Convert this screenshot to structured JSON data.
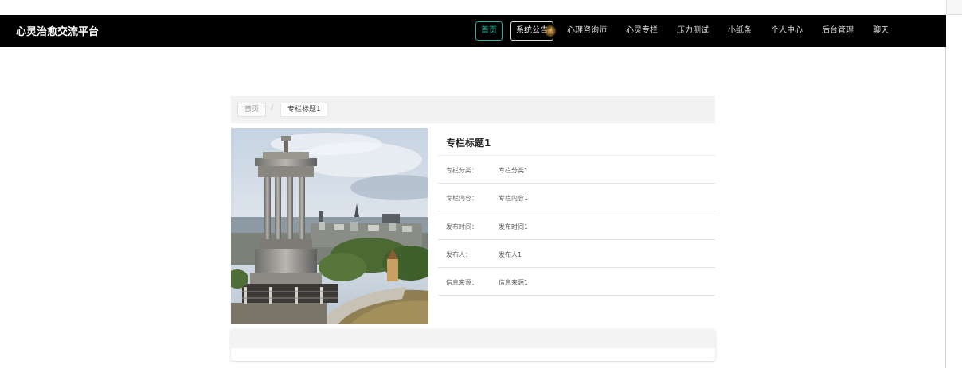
{
  "app": {
    "brand": "心灵治愈交流平台"
  },
  "nav": {
    "items": [
      {
        "label": "首页",
        "state": "active"
      },
      {
        "label": "系统公告",
        "state": "hover"
      },
      {
        "label": "心理咨询师",
        "state": "normal"
      },
      {
        "label": "心灵专栏",
        "state": "normal"
      },
      {
        "label": "压力测试",
        "state": "normal"
      },
      {
        "label": "小纸条",
        "state": "normal"
      },
      {
        "label": "个人中心",
        "state": "normal"
      },
      {
        "label": "后台管理",
        "state": "normal"
      },
      {
        "label": "聊天",
        "state": "normal"
      }
    ]
  },
  "breadcrumb": {
    "home": "首页",
    "separator": "/",
    "current": "专栏标题1"
  },
  "detail": {
    "title": "专栏标题1",
    "fields": [
      {
        "label": "专栏分类：",
        "value": "专栏分类1"
      },
      {
        "label": "专栏内容：",
        "value": "专栏内容1"
      },
      {
        "label": "发布时间：",
        "value": "发布时间1"
      },
      {
        "label": "发布人：",
        "value": "发布人1"
      },
      {
        "label": "信息来源：",
        "value": "信息来源1"
      }
    ]
  },
  "colors": {
    "accent": "#1fb5a7",
    "navbar": "#000000"
  },
  "icons": {
    "cursor": "hand-pointer-icon"
  }
}
